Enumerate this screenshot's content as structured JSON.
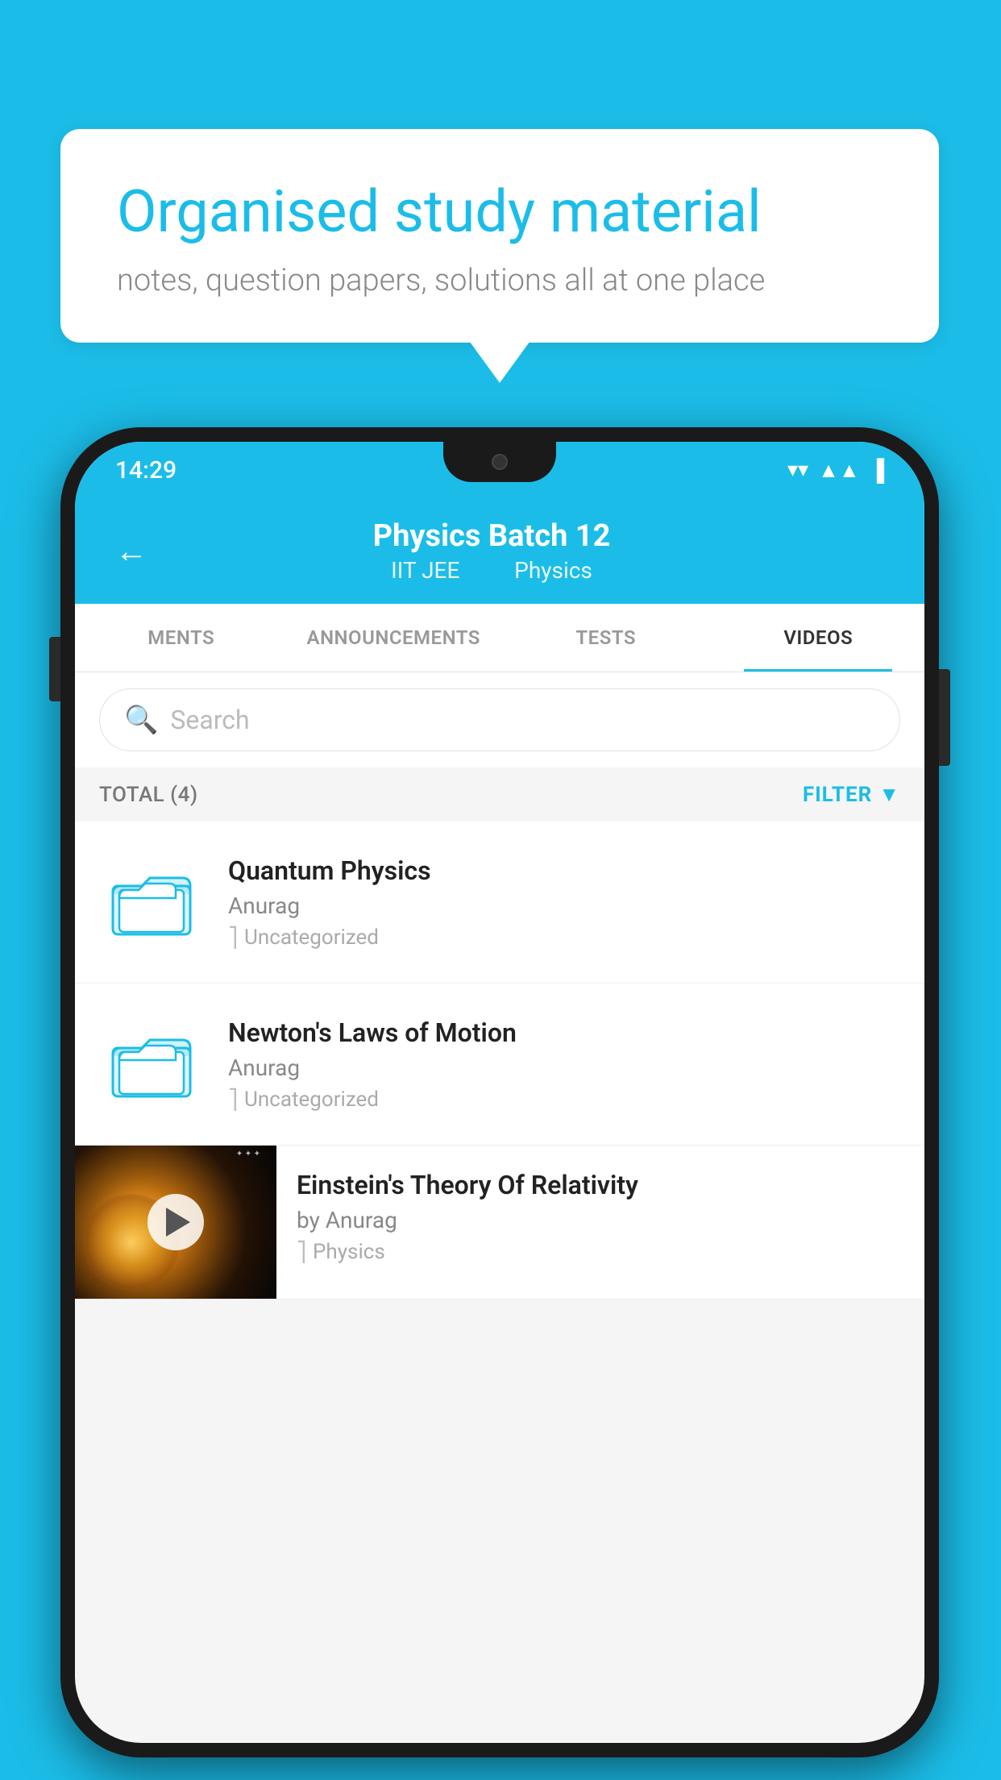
{
  "background": {
    "color": "#1BBDE8"
  },
  "speech_bubble": {
    "title": "Organised study material",
    "subtitle": "notes, question papers, solutions all at one place"
  },
  "status_bar": {
    "time": "14:29",
    "wifi": "▾",
    "signal": "▴",
    "battery": "▐"
  },
  "app_header": {
    "back_label": "←",
    "title": "Physics Batch 12",
    "tag1": "IIT JEE",
    "tag2": "Physics"
  },
  "tabs": [
    {
      "label": "MENTS",
      "active": false
    },
    {
      "label": "ANNOUNCEMENTS",
      "active": false
    },
    {
      "label": "TESTS",
      "active": false
    },
    {
      "label": "VIDEOS",
      "active": true
    }
  ],
  "search": {
    "placeholder": "Search"
  },
  "filter_bar": {
    "total_label": "TOTAL (4)",
    "filter_label": "FILTER"
  },
  "video_items": [
    {
      "title": "Quantum Physics",
      "author": "Anurag",
      "tag": "Uncategorized",
      "type": "folder"
    },
    {
      "title": "Newton's Laws of Motion",
      "author": "Anurag",
      "tag": "Uncategorized",
      "type": "folder"
    },
    {
      "title": "Einstein's Theory Of Relativity",
      "author": "by Anurag",
      "tag": "Physics",
      "type": "video"
    }
  ]
}
